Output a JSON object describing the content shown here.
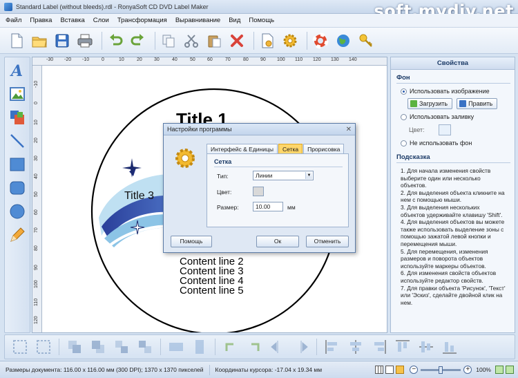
{
  "window": {
    "title": "Standard Label (without bleeds).rdl - RonyaSoft CD DVD Label Maker",
    "watermark": "soft.mydiv.net"
  },
  "menu": [
    "Файл",
    "Правка",
    "Вставка",
    "Слои",
    "Трансформация",
    "Выравнивание",
    "Вид",
    "Помощь"
  ],
  "toolbar": [
    "new-file-icon",
    "open-folder-icon",
    "save-icon",
    "print-icon",
    "undo-icon",
    "redo-icon",
    "copy-icon",
    "cut-icon",
    "paste-icon",
    "delete-icon",
    "page-setup-icon",
    "settings-gear-icon",
    "help-lifebuoy-icon",
    "website-globe-icon",
    "key-icon"
  ],
  "left_tools": [
    "text-tool-icon",
    "image-tool-icon",
    "shapes-tool-icon",
    "line-tool-icon",
    "rectangle-tool-icon",
    "rounded-rect-tool-icon",
    "ellipse-tool-icon",
    "pencil-tool-icon"
  ],
  "rulers": {
    "top": [
      "-30",
      "-20",
      "-10",
      "0",
      "10",
      "20",
      "30",
      "40",
      "50",
      "60",
      "70",
      "80",
      "90",
      "100",
      "110",
      "120",
      "130",
      "140"
    ],
    "left": [
      "-10",
      "0",
      "10",
      "20",
      "30",
      "40",
      "50",
      "60",
      "70",
      "80",
      "90",
      "100",
      "110",
      "120"
    ]
  },
  "label": {
    "title1": "Title 1",
    "title3": "Title 3",
    "content_lines": [
      "Content line 2",
      "Content line 3",
      "Content line 4",
      "Content line 5"
    ]
  },
  "properties": {
    "header": "Свойства",
    "background_section": "Фон",
    "use_image": "Использовать изображение",
    "load_button": "Загрузить",
    "edit_button": "Править",
    "use_fill": "Использовать заливку",
    "color_label": "Цвет:",
    "no_background": "Не использовать фон",
    "hint_section": "Подсказка",
    "hint_lines": [
      "1. Для начала изменения свойств",
      "выберите один или несколько",
      "объектов.",
      "2. Для выделения объекта кликните на",
      "нем с помощью мыши.",
      "3. Для выделения нескольких",
      "объектов удерживайте клавишу 'Shift'.",
      "4. Для выделения объектов вы можете",
      "также использовать выделение зоны с",
      "помощью зажатой левой кнопки и",
      "перемещения мыши.",
      "5. Для перемещения, изменения",
      "размеров и поворота объектов",
      "используйте маркеры объектов.",
      "6. Для изменения свойств объектов",
      "используйте редактор свойств.",
      "7. Для правки объекта 'Рисунок', 'Текст'",
      "или 'Эскиз', сделайте двойной клик на",
      "нем."
    ]
  },
  "dialog": {
    "title": "Настройки программы",
    "close": "✕",
    "tabs": [
      "Интерфейс & Единицы",
      "Сетка",
      "Прорисовка"
    ],
    "active_tab": "Сетка",
    "group_title": "Сетка",
    "type_label": "Тип:",
    "type_value": "Линии",
    "color_label": "Цвет:",
    "size_label": "Размер:",
    "size_value": "10.00",
    "size_unit": "мм",
    "help_button": "Помощь",
    "ok_button": "Ок",
    "cancel_button": "Отменить"
  },
  "status": {
    "doc_size": "Размеры документа: 116.00 x 116.00 мм (300 DPI); 1370 x 1370 пикселей",
    "cursor": "Координаты курсора: -17.04 x 19.34 мм",
    "zoom": "100%"
  },
  "colors": {
    "accent": "#2b5cb0",
    "dialog_tab_active": "#ffd66a",
    "panel_bg": "#f3f7fc"
  }
}
